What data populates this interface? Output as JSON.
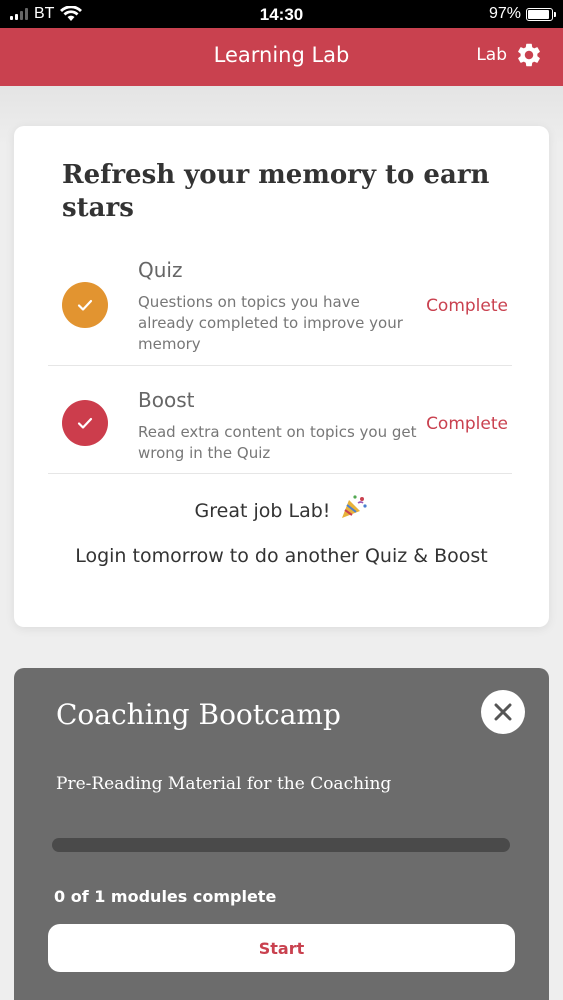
{
  "status_bar": {
    "carrier": "BT",
    "time": "14:30",
    "battery": "97%",
    "battery_level": 0.97
  },
  "nav": {
    "title": "Learning Lab",
    "user_name": "Lab",
    "settings_icon": "gear-icon"
  },
  "streak_card": {
    "title": "Refresh your memory to earn stars",
    "items": [
      {
        "title": "Quiz",
        "description": "Questions on topics you have already completed to improve your memory",
        "status": "Complete",
        "icon": "check-icon",
        "color": "#e29430"
      },
      {
        "title": "Boost",
        "description": "Read extra content on topics you get wrong in the Quiz",
        "status": "Complete",
        "icon": "check-icon",
        "color": "#cc3d4c"
      }
    ],
    "congrats": "Great job Lab!",
    "congrats_icon": "party-popper-icon",
    "login_message": "Login tomorrow to do another Quiz & Boost"
  },
  "course": {
    "title": "Coaching Bootcamp",
    "subtitle": "Pre-Reading Material for the Coaching",
    "progress": 0,
    "modules_text": "0 of 1 modules complete",
    "start_label": "Start",
    "close_icon": "close-icon"
  },
  "colors": {
    "brand": "#c9414f",
    "quiz": "#e29430",
    "boost": "#cc3d4c",
    "panel": "#6c6c6c"
  }
}
